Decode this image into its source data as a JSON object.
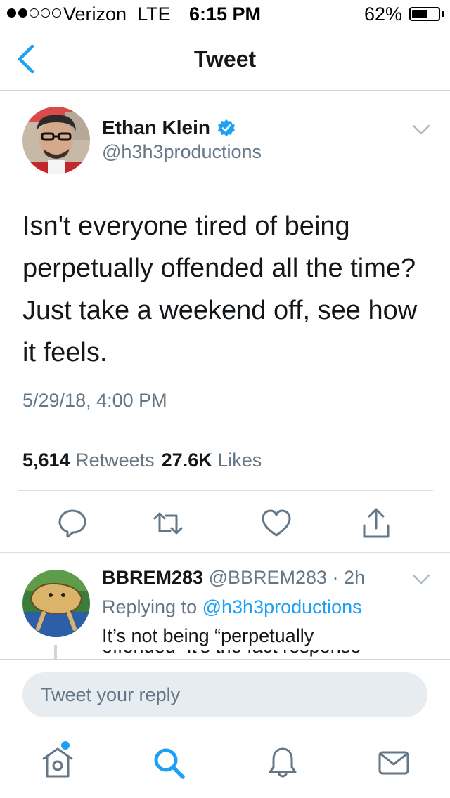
{
  "status_bar": {
    "carrier": "Verizon",
    "network": "LTE",
    "time": "6:15 PM",
    "battery_percent": "62%",
    "battery_level": 0.62,
    "signal_bars": 2
  },
  "nav": {
    "title": "Tweet",
    "back_icon": "chevron-left-icon"
  },
  "tweet": {
    "author_name": "Ethan Klein",
    "author_handle": "@h3h3productions",
    "verified": true,
    "text": "Isn't everyone tired of being perpetually offended all the time? Just take a weekend off, see how it feels.",
    "timestamp": "5/29/18, 4:00 PM",
    "retweet_count": "5,614",
    "retweet_label": "Retweets",
    "like_count": "27.6K",
    "like_label": "Likes",
    "actions": [
      "reply-icon",
      "retweet-icon",
      "heart-icon",
      "share-icon"
    ]
  },
  "reply": {
    "author_name": "BBREM283",
    "author_handle": "@BBREM283",
    "time_ago": "2h",
    "replying_to_label": "Replying to",
    "replying_to_handle": "@h3h3productions",
    "text_line1": "It’s not being “perpetually",
    "text_line2": "offended” it’s the fact response"
  },
  "reply_bar": {
    "placeholder": "Tweet your reply"
  },
  "tab_bar": {
    "tabs": [
      "home-icon",
      "search-icon",
      "notifications-icon",
      "messages-icon"
    ],
    "home_has_notification": true
  },
  "colors": {
    "accent": "#1da1f2",
    "text_primary": "#14171a",
    "text_secondary": "#657786",
    "separator": "#d8dee3",
    "input_bg": "#e6ecf0"
  }
}
